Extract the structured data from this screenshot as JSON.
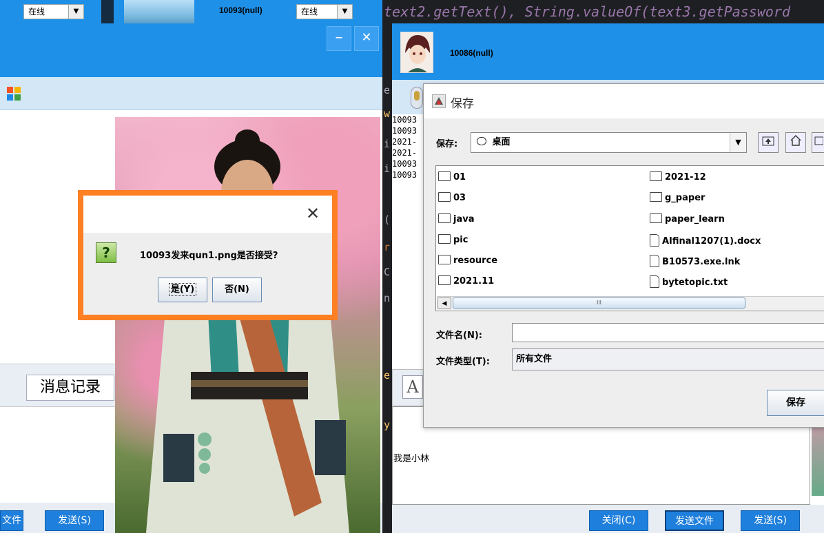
{
  "left_window": {
    "status_combo": "在线",
    "strip_user": "10093(null)",
    "strip_status": "在线",
    "minimize": "–",
    "close": "✕",
    "history_button": "消息记录",
    "send_file_partial": "文件",
    "send_button": "发送(S)"
  },
  "editor": {
    "code_line": "text2.getText(), String.valueOf(text3.getPassword",
    "gutter_letters": [
      "e",
      "w",
      "i",
      "i",
      "(",
      "r",
      "C",
      "n",
      "e",
      "y"
    ]
  },
  "right_window": {
    "user_name": "10086(null)",
    "history_lines": [
      "10093",
      "10093",
      "2021-",
      "2021-",
      "10093",
      "10093"
    ],
    "format_glyph": "A",
    "input_text": "我是小林",
    "close_button": "关闭(C)",
    "send_file_button": "发送文件",
    "send_button": "发送(S)"
  },
  "save_dialog": {
    "title": "保存",
    "save_in_label": "保存:",
    "location": "桌面",
    "tool_icons": [
      "up-folder-icon",
      "home-icon",
      "new-folder-icon"
    ],
    "files_col1": [
      "01",
      "03",
      "java",
      "pic",
      "resource",
      "2021.11"
    ],
    "files_col2": [
      {
        "name": "2021-12",
        "type": "folder"
      },
      {
        "name": "g_paper",
        "type": "folder"
      },
      {
        "name": "paper_learn",
        "type": "folder"
      },
      {
        "name": "AIfinal1207(1).docx",
        "type": "file"
      },
      {
        "name": "B10573.exe.lnk",
        "type": "file"
      },
      {
        "name": "bytetopic.txt",
        "type": "file"
      }
    ],
    "scroll_grip": "III",
    "filename_label": "文件名(N):",
    "filename_value": "",
    "filetype_label": "文件类型(T):",
    "filetype_value": "所有文件",
    "save_button": "保存"
  },
  "confirm_dialog": {
    "icon": "?",
    "message": "10093发来qun1.png是否接受?",
    "yes_button": "是(Y)",
    "no_button": "否(N)",
    "close": "✕"
  },
  "colors": {
    "header_blue": "#1e90e8",
    "highlight_orange": "#ff7f23",
    "button_blue": "#1f7fdc"
  }
}
